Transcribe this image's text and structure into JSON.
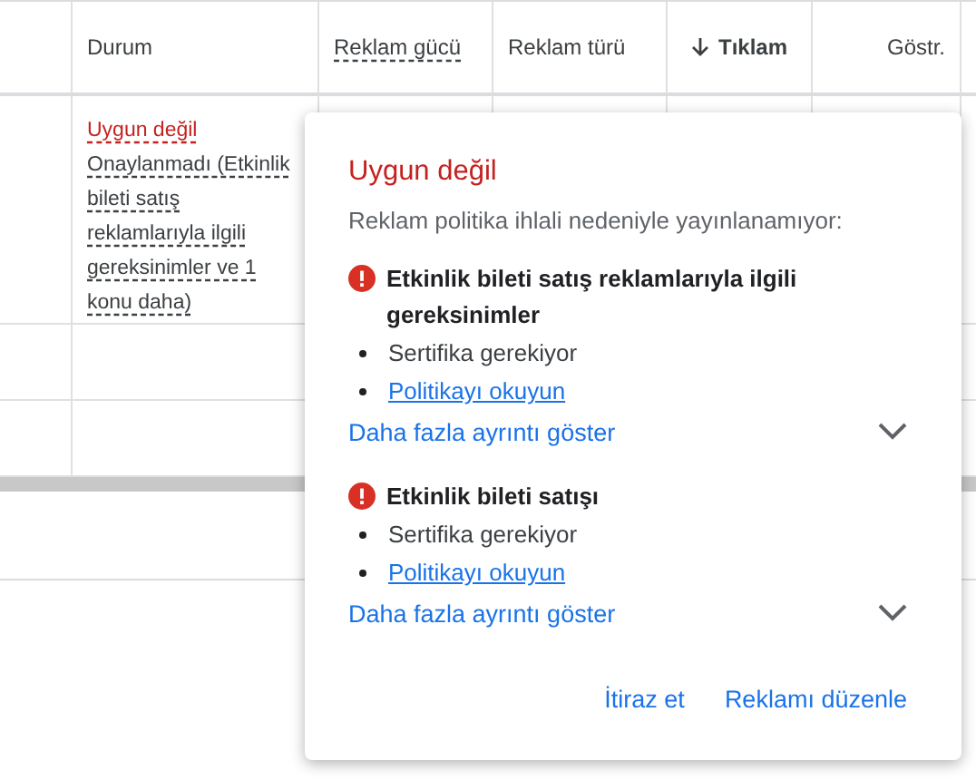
{
  "table": {
    "columns": [
      {
        "label": "Durum",
        "kind": "plain"
      },
      {
        "label": "Reklam gücü",
        "kind": "tooltip"
      },
      {
        "label": "Reklam türü",
        "kind": "plain"
      },
      {
        "label": "Tıklam",
        "kind": "sorted"
      },
      {
        "label": "Göstr.",
        "kind": "numeric"
      }
    ],
    "row": {
      "status": "Uygun değil",
      "detail": "Onaylanmadı (Etkinlik bileti satış reklamlarıyla ilgili gereksinimler ve 1 konu daha)"
    }
  },
  "popup": {
    "title": "Uygun değil",
    "subtitle": "Reklam politika ihlali nedeniyle yayınlanamıyor:",
    "issues": [
      {
        "title": "Etkinlik bileti satış reklamlarıyla ilgili gereksinimler",
        "items": [
          {
            "kind": "text",
            "text": "Sertifika gerekiyor"
          },
          {
            "kind": "link",
            "text": "Politikayı okuyun"
          }
        ],
        "more": "Daha fazla ayrıntı göster",
        "expanded": false
      },
      {
        "title": "Etkinlik bileti satışı",
        "items": [
          {
            "kind": "text",
            "text": "Sertifika gerekiyor"
          },
          {
            "kind": "link",
            "text": "Politikayı okuyun"
          }
        ],
        "more": "Daha fazla ayrıntı göster",
        "expanded": false
      }
    ],
    "actions": [
      "İtiraz et",
      "Reklamı düzenle"
    ]
  }
}
